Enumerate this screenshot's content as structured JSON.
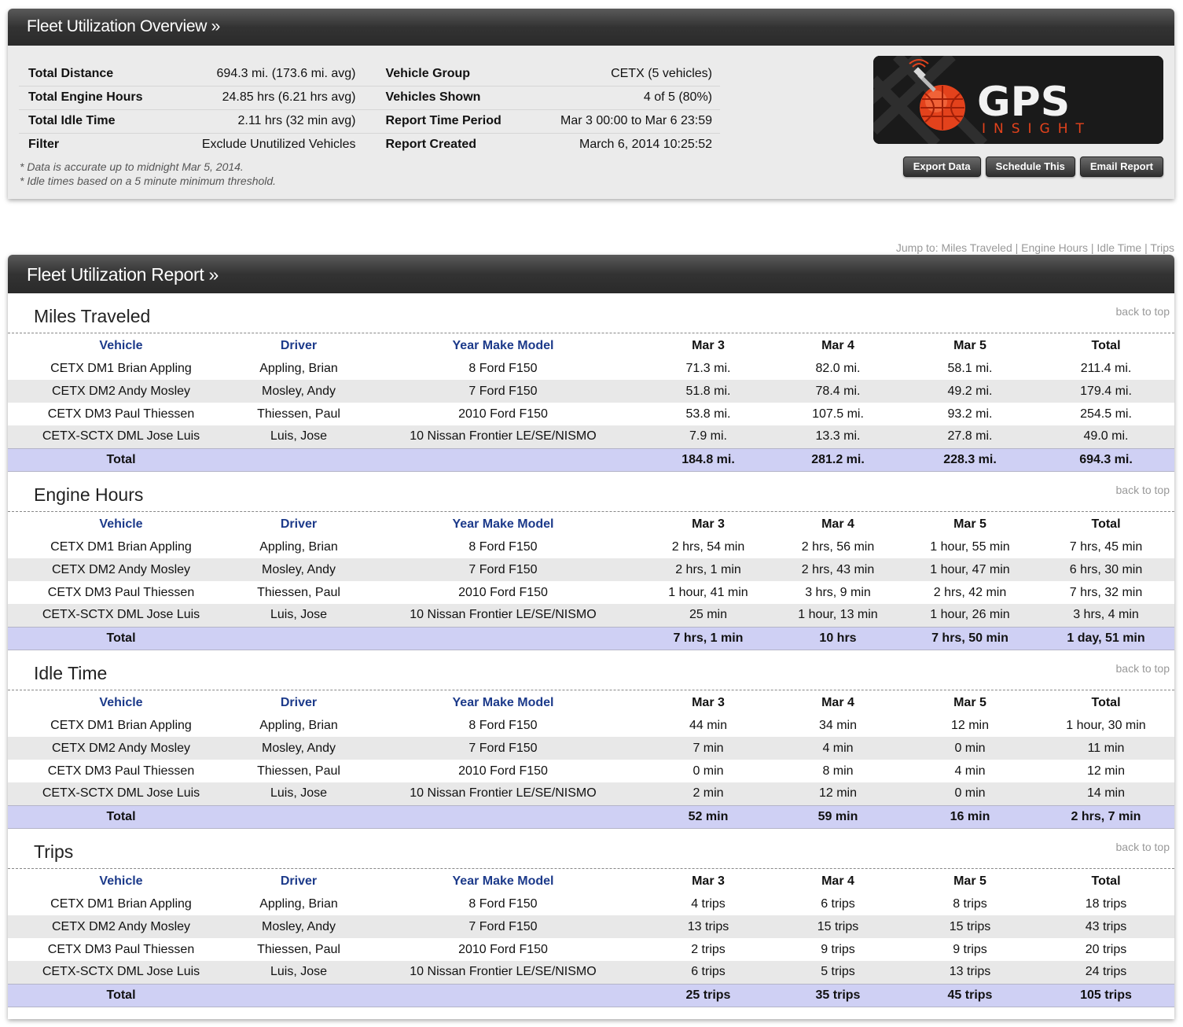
{
  "overview": {
    "title": "Fleet Utilization Overview »",
    "stats_left": [
      {
        "label": "Total Distance",
        "value": "694.3 mi. (173.6 mi. avg)"
      },
      {
        "label": "Total Engine Hours",
        "value": "24.85 hrs (6.21 hrs avg)"
      },
      {
        "label": "Total Idle Time",
        "value": "2.11 hrs (32 min avg)"
      },
      {
        "label": "Filter",
        "value": "Exclude Unutilized Vehicles"
      }
    ],
    "stats_right": [
      {
        "label": "Vehicle Group",
        "value": "CETX (5 vehicles)"
      },
      {
        "label": "Vehicles Shown",
        "value": "4 of 5 (80%)"
      },
      {
        "label": "Report Time Period",
        "value": "Mar 3 00:00 to Mar 6 23:59"
      },
      {
        "label": "Report Created",
        "value": "March 6, 2014 10:25:52"
      }
    ],
    "notes": [
      "* Data is accurate up to midnight Mar 5, 2014.",
      "* Idle times based on a 5 minute minimum threshold."
    ],
    "logo": {
      "word": "GPS",
      "sub": "INSIGHT"
    },
    "buttons": [
      "Export Data",
      "Schedule This",
      "Email Report"
    ]
  },
  "jump": {
    "label": "Jump to:",
    "links": [
      "Miles Traveled",
      "Engine Hours",
      "Idle Time",
      "Trips"
    ]
  },
  "report": {
    "title": "Fleet Utilization Report »",
    "back_to_top": "back to top",
    "columns": [
      "Vehicle",
      "Driver",
      "Year Make Model",
      "Mar 3",
      "Mar 4",
      "Mar 5",
      "Total"
    ],
    "total_label": "Total",
    "vehicles": [
      {
        "vehicle": "CETX DM1 Brian Appling",
        "driver": "Appling, Brian",
        "model": "8 Ford F150"
      },
      {
        "vehicle": "CETX DM2 Andy Mosley",
        "driver": "Mosley, Andy",
        "model": "7 Ford F150"
      },
      {
        "vehicle": "CETX DM3 Paul Thiessen",
        "driver": "Thiessen, Paul",
        "model": "2010 Ford F150"
      },
      {
        "vehicle": "CETX-SCTX DML Jose Luis",
        "driver": "Luis, Jose",
        "model": "10 Nissan Frontier LE/SE/NISMO"
      }
    ],
    "sections": [
      {
        "title": "Miles Traveled",
        "rows": [
          [
            "71.3 mi.",
            "82.0 mi.",
            "58.1 mi.",
            "211.4 mi."
          ],
          [
            "51.8 mi.",
            "78.4 mi.",
            "49.2 mi.",
            "179.4 mi."
          ],
          [
            "53.8 mi.",
            "107.5 mi.",
            "93.2 mi.",
            "254.5 mi."
          ],
          [
            "7.9 mi.",
            "13.3 mi.",
            "27.8 mi.",
            "49.0 mi."
          ]
        ],
        "totals": [
          "184.8 mi.",
          "281.2 mi.",
          "228.3 mi.",
          "694.3 mi."
        ]
      },
      {
        "title": "Engine Hours",
        "rows": [
          [
            "2 hrs, 54 min",
            "2 hrs, 56 min",
            "1 hour, 55 min",
            "7 hrs, 45 min"
          ],
          [
            "2 hrs, 1 min",
            "2 hrs, 43 min",
            "1 hour, 47 min",
            "6 hrs, 30 min"
          ],
          [
            "1 hour, 41 min",
            "3 hrs, 9 min",
            "2 hrs, 42 min",
            "7 hrs, 32 min"
          ],
          [
            "25 min",
            "1 hour, 13 min",
            "1 hour, 26 min",
            "3 hrs, 4 min"
          ]
        ],
        "totals": [
          "7 hrs, 1 min",
          "10 hrs",
          "7 hrs, 50 min",
          "1 day, 51 min"
        ]
      },
      {
        "title": "Idle Time",
        "rows": [
          [
            "44 min",
            "34 min",
            "12 min",
            "1 hour, 30 min"
          ],
          [
            "7 min",
            "4 min",
            "0 min",
            "11 min"
          ],
          [
            "0 min",
            "8 min",
            "4 min",
            "12 min"
          ],
          [
            "2 min",
            "12 min",
            "0 min",
            "14 min"
          ]
        ],
        "totals": [
          "52 min",
          "59 min",
          "16 min",
          "2 hrs, 7 min"
        ]
      },
      {
        "title": "Trips",
        "rows": [
          [
            "4 trips",
            "6 trips",
            "8 trips",
            "18 trips"
          ],
          [
            "13 trips",
            "15 trips",
            "15 trips",
            "43 trips"
          ],
          [
            "2 trips",
            "9 trips",
            "9 trips",
            "20 trips"
          ],
          [
            "6 trips",
            "5 trips",
            "13 trips",
            "24 trips"
          ]
        ],
        "totals": [
          "25 trips",
          "35 trips",
          "45 trips",
          "105 trips"
        ]
      }
    ]
  }
}
